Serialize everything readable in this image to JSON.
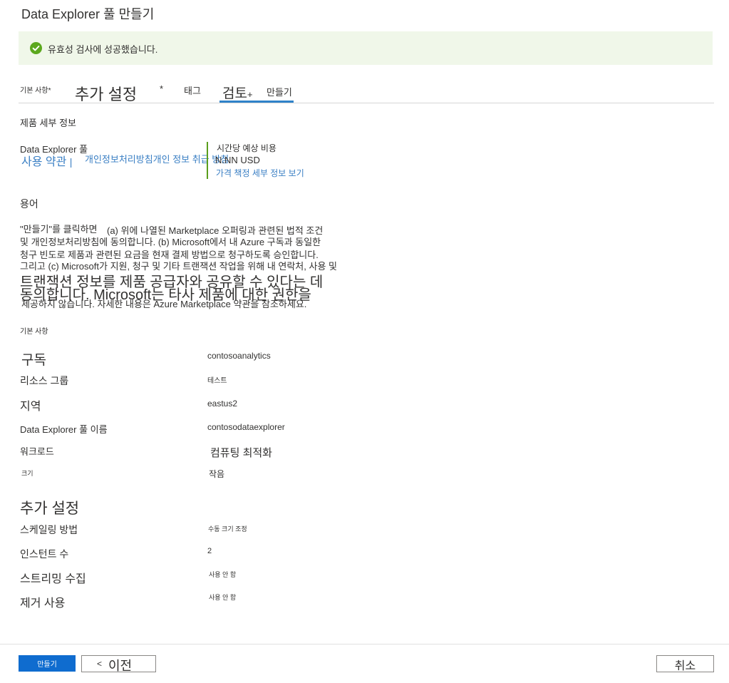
{
  "window": {
    "title": "Data Explorer 풀 만들기"
  },
  "banner": {
    "text": "유효성 검사에 성공했습니다.",
    "status_color": "#5ca81e"
  },
  "tabs": {
    "basics": "기본 사항",
    "basics_star": "*",
    "additional": "추가 설정",
    "additional_star": "*",
    "tags": "태그",
    "review": "검토",
    "review_plus": "+",
    "create": "만들기"
  },
  "product": {
    "section_title": "제품 세부 정보",
    "name": "Data Explorer 풀",
    "terms_link": "사용 약관",
    "separator": "|",
    "privacy_link": "개인정보처리방침개인 정보 취급 방침",
    "cost_label": "시간당 예상 비용",
    "cost_value": "N.NN USD",
    "pricing_link": "가격 책정 세부 정보 보기"
  },
  "terms": {
    "section_title": "용어",
    "line1_a": "\"만들기\"를 클릭하면",
    "line1_b": "(a) 위에 나열된 Marketplace 오퍼링과 관련된 법적 조건",
    "line2": "및 개인정보처리방침에 동의합니다. (b) Microsoft에서 내 Azure 구독과 동일한",
    "line3": "청구 빈도로 제품과 관련된 요금을 현재 결제 방법으로 청구하도록 승인합니다.",
    "line4": "그리고 (c) Microsoft가 지원, 청구 및 기타 트랜잭션 작업을 위해 내 연락처, 사용 및",
    "line5": "트랜잭션 정보를 제품 공급자와 공유할 수 있다는 데",
    "line6": "동의합니다. Microsoft는 타사 제품에 대한 권한을",
    "line7": "제공하지 않습니다. 자세한 내용은 Azure Marketplace 약관을 참조하세요."
  },
  "basics_summary": {
    "section_title": "기본 사항",
    "rows": [
      {
        "label": "구독",
        "value": "contosoanalytics"
      },
      {
        "label": "리소스 그룹",
        "value": "테스트"
      },
      {
        "label": "지역",
        "value": "eastus2"
      },
      {
        "label": "Data Explorer 풀 이름",
        "value": "contosodataexplorer"
      },
      {
        "label": "워크로드",
        "value": "컴퓨팅 최적화"
      },
      {
        "label": "크기",
        "value": "작음"
      }
    ]
  },
  "additional_summary": {
    "section_title": "추가 설정",
    "rows": [
      {
        "label": "스케일링 방법",
        "value": "수동 크기 조정"
      },
      {
        "label": "인스턴트 수",
        "value": "2"
      },
      {
        "label": "스트리밍 수집",
        "value": "사용 안 함"
      },
      {
        "label": "제거 사용",
        "value": "사용 안 함"
      }
    ]
  },
  "footer": {
    "create_label": "만들기",
    "prev_chevron": "<",
    "prev_label": "이전",
    "cancel_label": "취소",
    "primary_color": "#0f6ccf"
  }
}
